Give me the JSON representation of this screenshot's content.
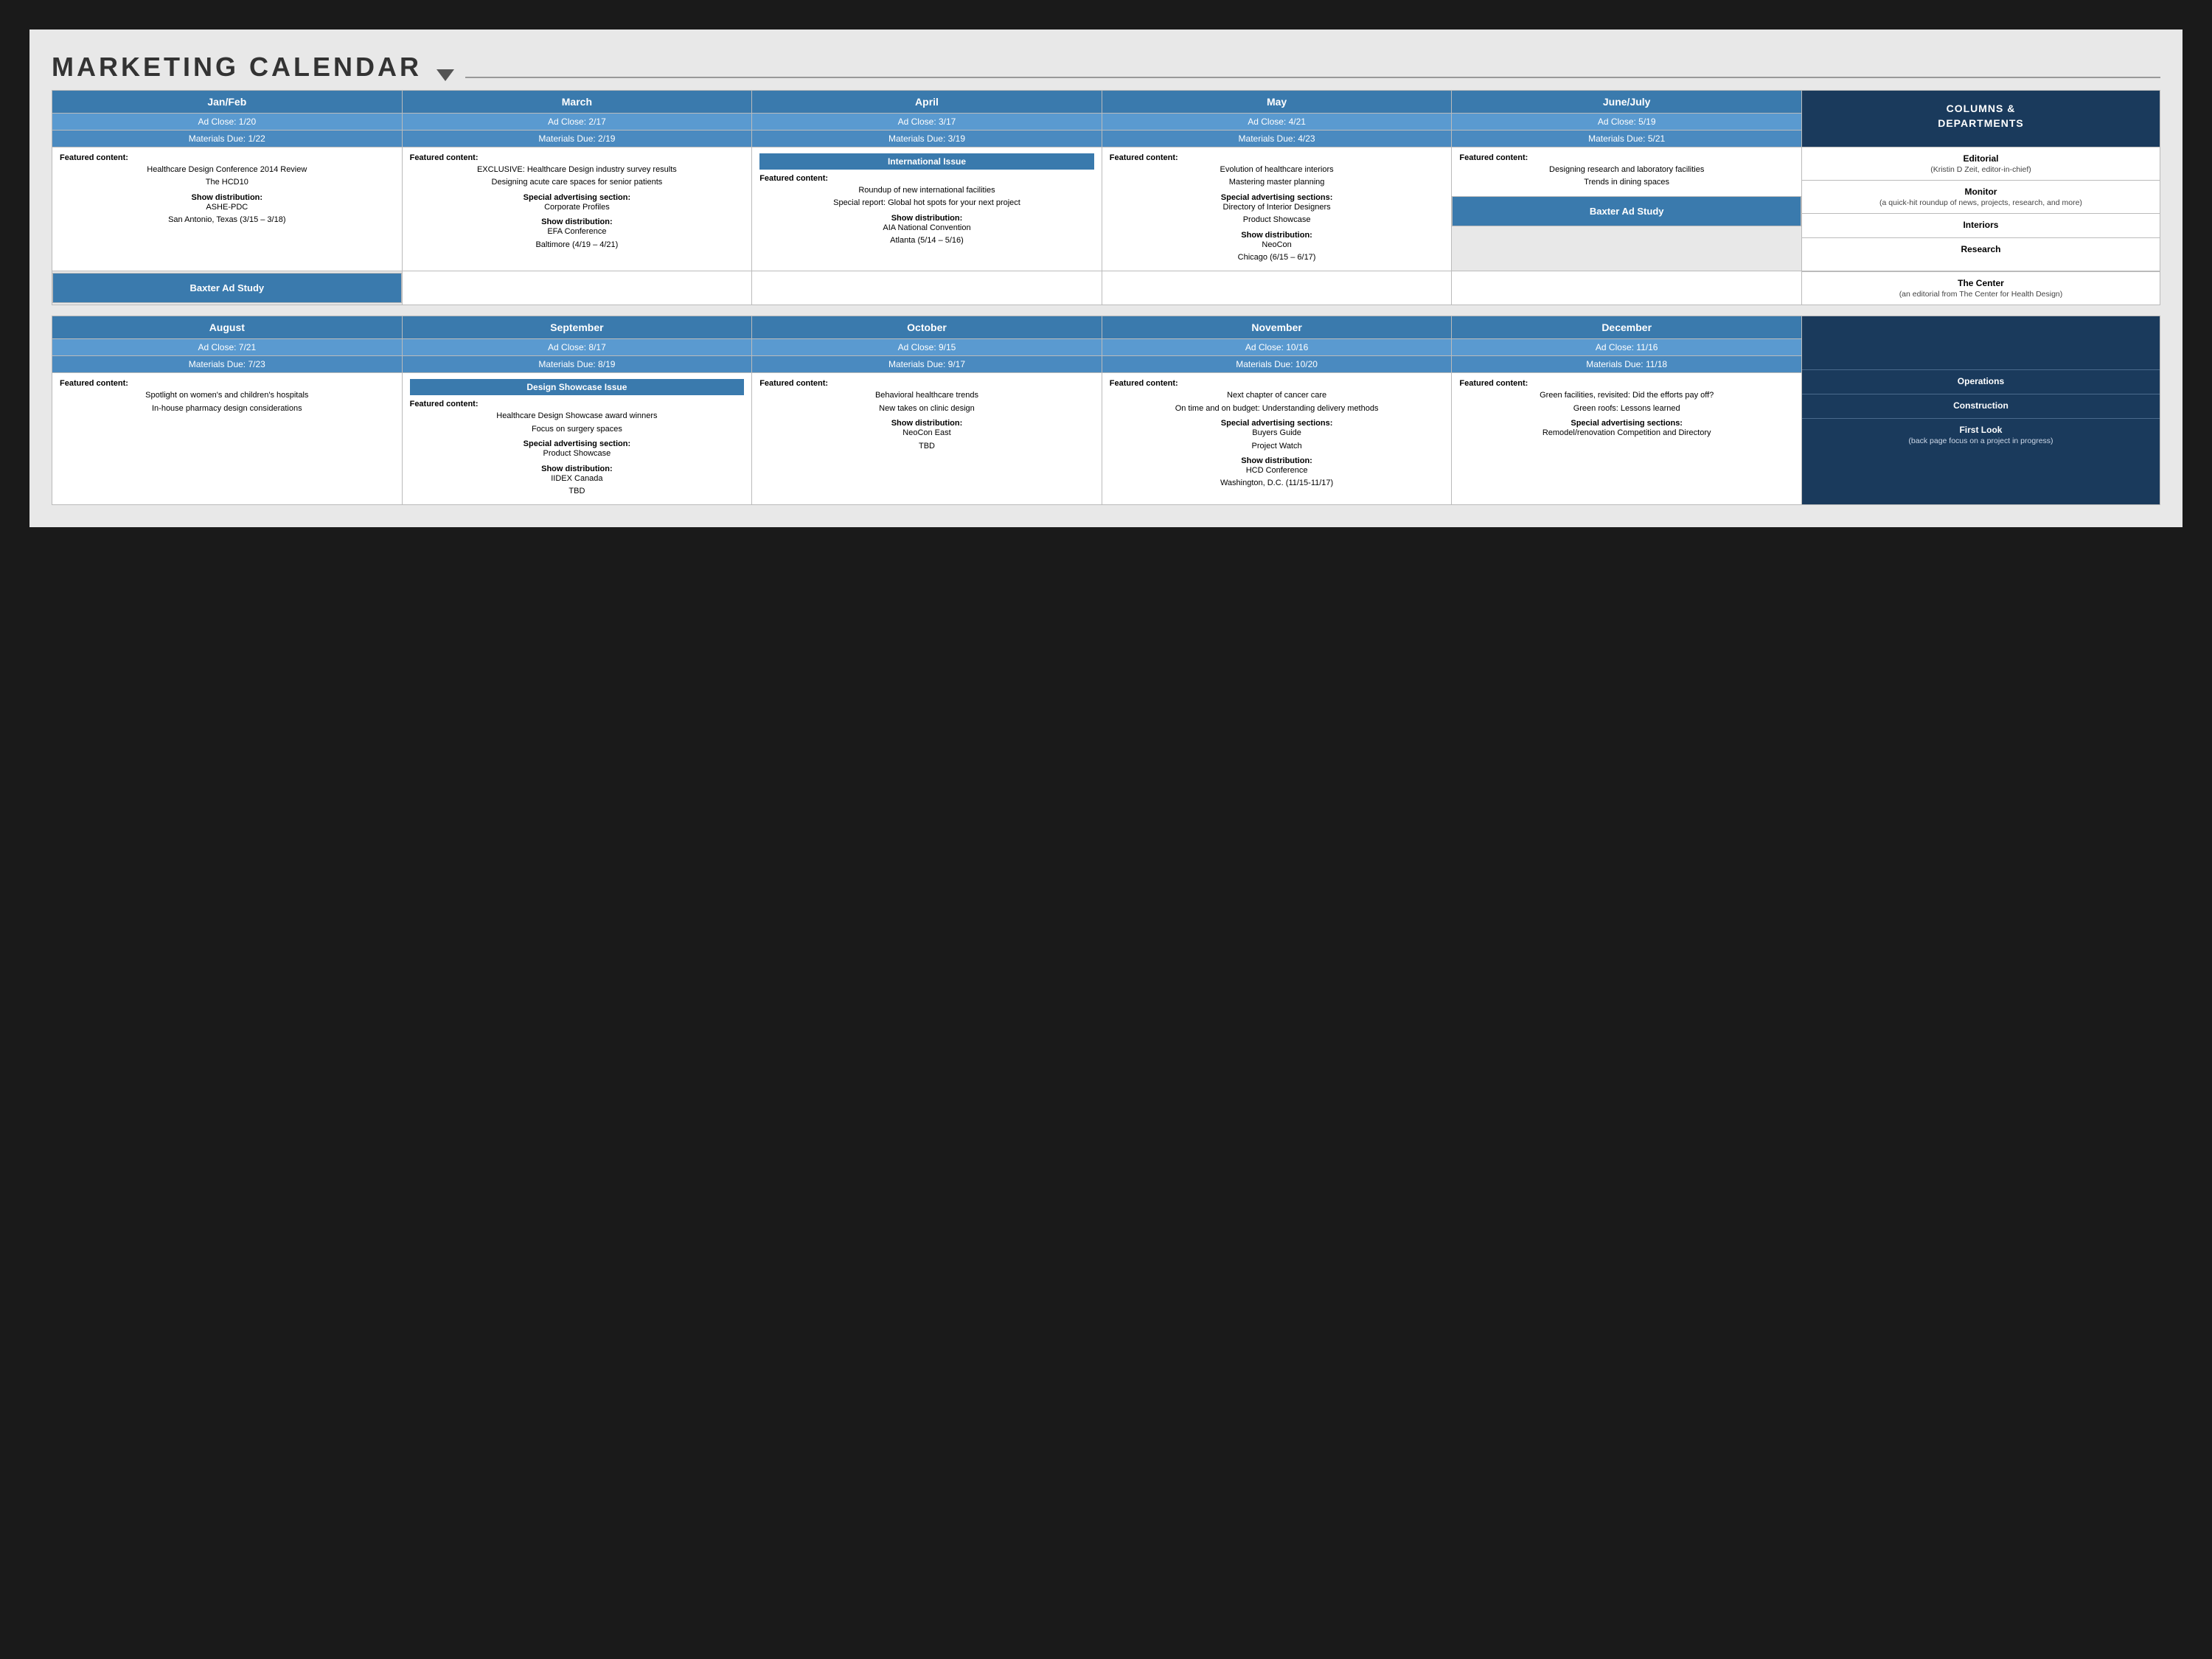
{
  "title": "MARKETING CALENDAR",
  "top_half": {
    "months": [
      {
        "name": "Jan/Feb",
        "ad_close": "Ad Close: 1/20",
        "materials_due": "Materials Due: 1/22",
        "featured_label": "Featured content:",
        "featured_items": [
          "Healthcare Design Conference 2014 Review",
          "The HCD10"
        ],
        "show_label": "Show distribution:",
        "show_items": [
          "ASHE-PDC",
          "San Antonio, Texas (3/15 – 3/18)"
        ],
        "special": null,
        "special_items": [],
        "extra_label": null,
        "extra_items": [],
        "baxter": "Baxter Ad Study",
        "baxter_cell": true,
        "international": false
      },
      {
        "name": "March",
        "ad_close": "Ad Close: 2/17",
        "materials_due": "Materials Due: 2/19",
        "featured_label": "Featured content:",
        "featured_items": [
          "EXCLUSIVE: Healthcare Design industry survey results",
          "Designing acute care spaces for senior patients"
        ],
        "special_label": "Special advertising section:",
        "special_items": [
          "Corporate Profiles"
        ],
        "show_label": "Show distribution:",
        "show_items": [
          "EFA Conference",
          "Baltimore (4/19 – 4/21)"
        ],
        "extra_label": null,
        "extra_items": [],
        "baxter": false,
        "baxter_cell": false,
        "international": false
      },
      {
        "name": "April",
        "ad_close": "Ad Close: 3/17",
        "materials_due": "Materials Due: 3/19",
        "international_label": "International Issue",
        "featured_label": "Featured content:",
        "featured_items": [
          "Roundup of new international facilities",
          "Special report: Global hot spots for your next project"
        ],
        "special": null,
        "special_items": [],
        "show_label": "Show distribution:",
        "show_items": [
          "AIA National Convention",
          "Atlanta (5/14 – 5/16)"
        ],
        "extra_label": null,
        "extra_items": [],
        "baxter": false,
        "baxter_cell": false,
        "international": true
      },
      {
        "name": "May",
        "ad_close": "Ad Close: 4/21",
        "materials_due": "Materials Due: 4/23",
        "featured_label": "Featured content:",
        "featured_items": [
          "Evolution of healthcare interiors",
          "Mastering master planning"
        ],
        "special_label": "Special advertising sections:",
        "special_items": [
          "Directory of Interior Designers",
          "Product Showcase"
        ],
        "show_label": "Show distribution:",
        "show_items": [
          "NeoCon",
          "Chicago (6/15 – 6/17)"
        ],
        "extra_label": null,
        "extra_items": [],
        "baxter": false,
        "baxter_cell": false,
        "international": false
      },
      {
        "name": "June/July",
        "ad_close": "Ad Close: 5/19",
        "materials_due": "Materials Due: 5/21",
        "featured_label": "Featured content:",
        "featured_items": [
          "Designing research and laboratory facilities",
          "Trends in dining spaces"
        ],
        "special": null,
        "special_items": [],
        "show_label": null,
        "show_items": [],
        "extra_label": null,
        "extra_items": [],
        "baxter": "Baxter Ad Study",
        "baxter_cell": true,
        "international": false
      }
    ]
  },
  "bottom_half": {
    "months": [
      {
        "name": "August",
        "ad_close": "Ad Close: 7/21",
        "materials_due": "Materials Due: 7/23",
        "featured_label": "Featured content:",
        "featured_items": [
          "Spotlight on women's and children's hospitals",
          "In-house pharmacy design considerations"
        ],
        "special": null,
        "special_items": [],
        "show_label": null,
        "show_items": [],
        "design_showcase": false,
        "design_showcase_label": null
      },
      {
        "name": "September",
        "ad_close": "Ad Close: 8/17",
        "materials_due": "Materials Due: 8/19",
        "design_showcase": true,
        "design_showcase_label": "Design Showcase Issue",
        "featured_label": "Featured content:",
        "featured_items": [
          "Healthcare Design Showcase award winners",
          "Focus on surgery spaces"
        ],
        "special_label": "Special advertising section:",
        "special_items": [
          "Product Showcase"
        ],
        "show_label": "Show distribution:",
        "show_items": [
          "IIDEX Canada",
          "TBD"
        ]
      },
      {
        "name": "October",
        "ad_close": "Ad Close: 9/15",
        "materials_due": "Materials Due: 9/17",
        "design_showcase": false,
        "featured_label": "Featured content:",
        "featured_items": [
          "Behavioral healthcare trends",
          "New takes on clinic design"
        ],
        "special": null,
        "special_items": [],
        "show_label": "Show distribution:",
        "show_items": [
          "NeoCon East",
          "TBD"
        ]
      },
      {
        "name": "November",
        "ad_close": "Ad Close: 10/16",
        "materials_due": "Materials Due: 10/20",
        "design_showcase": false,
        "featured_label": "Featured content:",
        "featured_items": [
          "Next chapter of cancer care",
          "On time and on budget: Understanding delivery methods"
        ],
        "special_label": "Special advertising sections:",
        "special_items": [
          "Buyers Guide",
          "Project Watch"
        ],
        "show_label": "Show distribution:",
        "show_items": [
          "HCD Conference",
          "Washington, D.C. (11/15-11/17)"
        ]
      },
      {
        "name": "December",
        "ad_close": "Ad Close: 11/16",
        "materials_due": "Materials Due: 11/18",
        "design_showcase": false,
        "featured_label": "Featured content:",
        "featured_items": [
          "Green facilities, revisited: Did the efforts pay off?",
          "Green roofs: Lessons learned"
        ],
        "special_label": "Special advertising sections:",
        "special_items": [
          "Remodel/renovation Competition and Directory"
        ],
        "show_label": null,
        "show_items": []
      }
    ]
  },
  "sidebar": {
    "title": "COLUMNS & DEPARTMENTS",
    "items": [
      {
        "name": "Editorial",
        "desc": "(Kristin D Zeit, editor-in-chief)"
      },
      {
        "name": "Monitor",
        "desc": "(a quick-hit roundup of news, projects, research, and more)"
      },
      {
        "name": "Interiors",
        "desc": ""
      },
      {
        "name": "Research",
        "desc": ""
      },
      {
        "name": "The Center",
        "desc": "(an editorial from The Center for Health Design)"
      },
      {
        "name": "Operations",
        "desc": ""
      },
      {
        "name": "Construction",
        "desc": ""
      },
      {
        "name": "First Look",
        "desc": "(back page focus on a project in progress)"
      }
    ]
  }
}
